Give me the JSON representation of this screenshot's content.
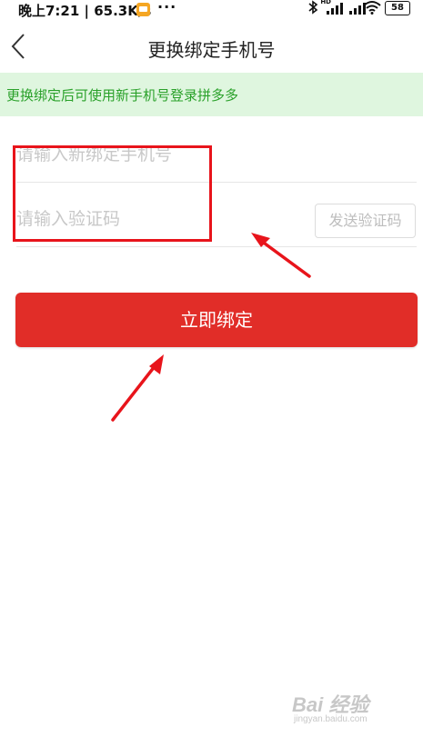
{
  "status_bar": {
    "time_info": "晚上7:21 | 65.3K/s",
    "more": "···",
    "battery": "58",
    "hd": "HD"
  },
  "nav": {
    "title": "更换绑定手机号"
  },
  "notice": {
    "text": "更换绑定后可使用新手机号登录拼多多",
    "color": "#2aa12a"
  },
  "form": {
    "phone_placeholder": "请输入新绑定手机号",
    "code_placeholder": "请输入验证码",
    "send_code_label": "发送验证码",
    "submit_label": "立即绑定"
  },
  "colors": {
    "primary": "#e12d28",
    "annotation": "#e8141b"
  },
  "watermark": {
    "main": "Bai 经验",
    "sub": "jingyan.baidu.com"
  }
}
